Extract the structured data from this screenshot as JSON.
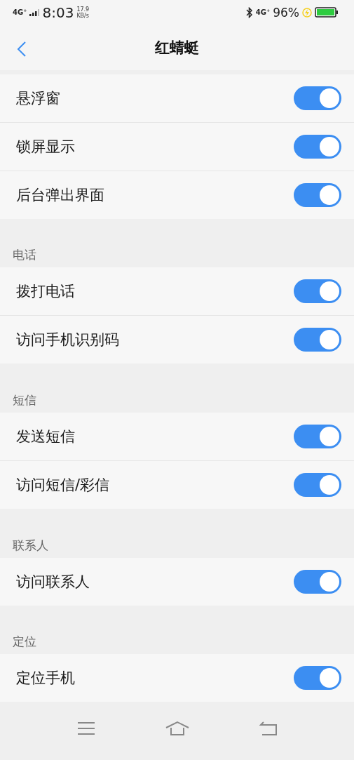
{
  "status_bar": {
    "network": "4G⁺",
    "time": "8:03",
    "speed_value": "17.9",
    "speed_unit": "KB/s",
    "network_right": "4G⁺",
    "battery": "96%"
  },
  "header": {
    "title": "红蜻蜓"
  },
  "sections": [
    {
      "rows": [
        {
          "label": "悬浮窗",
          "on": true
        },
        {
          "label": "锁屏显示",
          "on": true
        },
        {
          "label": "后台弹出界面",
          "on": true
        }
      ]
    },
    {
      "title": "电话",
      "rows": [
        {
          "label": "拨打电话",
          "on": true
        },
        {
          "label": "访问手机识别码",
          "on": true
        }
      ]
    },
    {
      "title": "短信",
      "rows": [
        {
          "label": "发送短信",
          "on": true
        },
        {
          "label": "访问短信/彩信",
          "on": true
        }
      ]
    },
    {
      "title": "联系人",
      "rows": [
        {
          "label": "访问联系人",
          "on": true
        }
      ]
    },
    {
      "title": "定位",
      "rows": [
        {
          "label": "定位手机",
          "on": true
        }
      ]
    }
  ]
}
